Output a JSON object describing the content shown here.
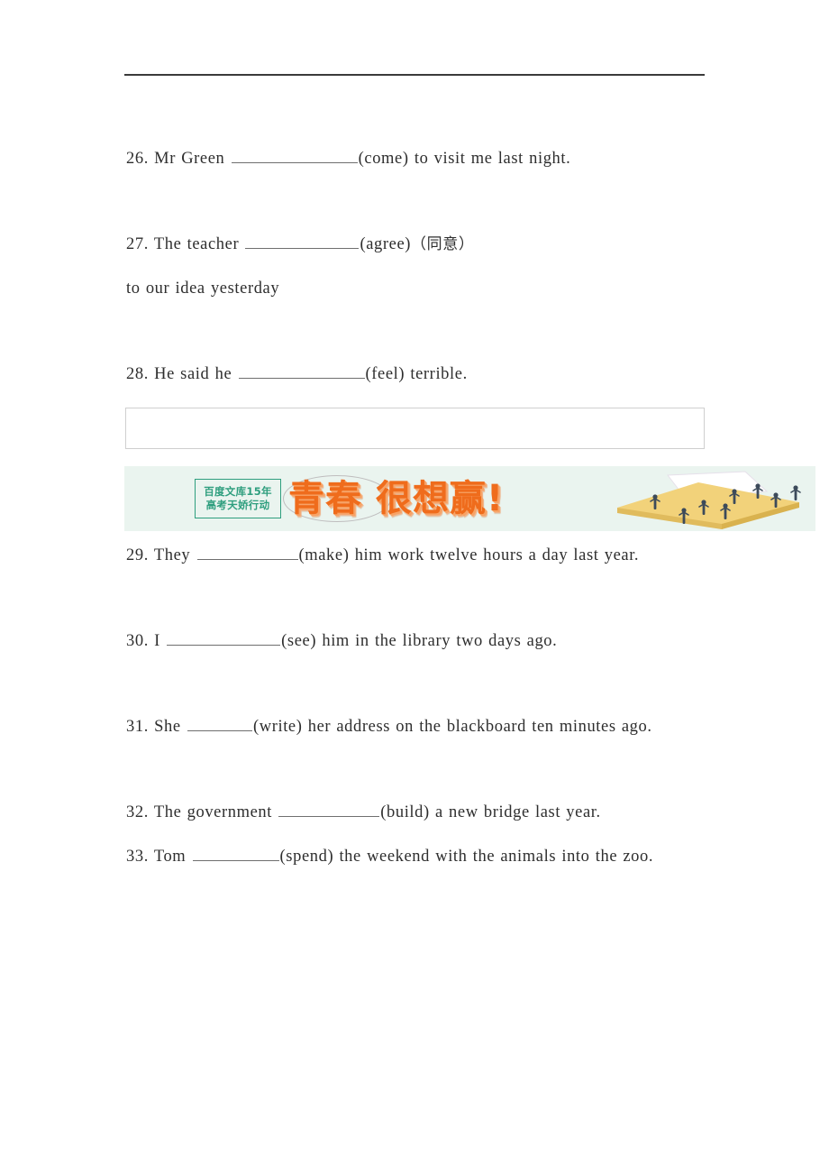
{
  "document": {
    "background_color": "#ffffff",
    "text_color": "#2e2e2e",
    "rule_color": "#3a3a3a"
  },
  "exercises": [
    {
      "number": "26.",
      "before": "Mr Green",
      "blank": "b-xl",
      "after": "(come) to visit me last night.",
      "cjk": ""
    },
    {
      "number": "27.",
      "before": "The teacher",
      "blank": "b-lg",
      "after": "(agree)",
      "cjk": "（同意）",
      "continuation": "to our idea yesterday"
    },
    {
      "number": "28.",
      "before": "He said he",
      "blank": "b-xl",
      "after": "(feel) terrible.",
      "cjk": ""
    },
    {
      "number": "29.",
      "before": "They",
      "blank": "b-md",
      "after": "(make) him work twelve hours a day last year.",
      "cjk": ""
    },
    {
      "number": "30.",
      "before": "I",
      "blank": "b-lg",
      "after": "(see) him in the library two days ago.",
      "cjk": ""
    },
    {
      "number": "31.",
      "before": "She",
      "blank": "b-xs",
      "after": "(write) her address on the blackboard ten minutes ago.",
      "cjk": ""
    },
    {
      "number": "32.",
      "before": "The government",
      "blank": "b-md",
      "after": "(build) a new bridge last year.",
      "cjk": ""
    },
    {
      "number": "33.",
      "before": "Tom",
      "blank": "b-sm",
      "after": "(spend) the weekend with the animals into the zoo.",
      "cjk": ""
    }
  ],
  "banner": {
    "background_color": "#eaf4ef",
    "logo_line1": "百度文库15年",
    "logo_line2": "高考天娇行动",
    "logo_border_color": "#2e9e7e",
    "slogan": "青春 很想赢!",
    "slogan_color": "#ef6c1c",
    "illustration_color": "#f2d27a"
  }
}
